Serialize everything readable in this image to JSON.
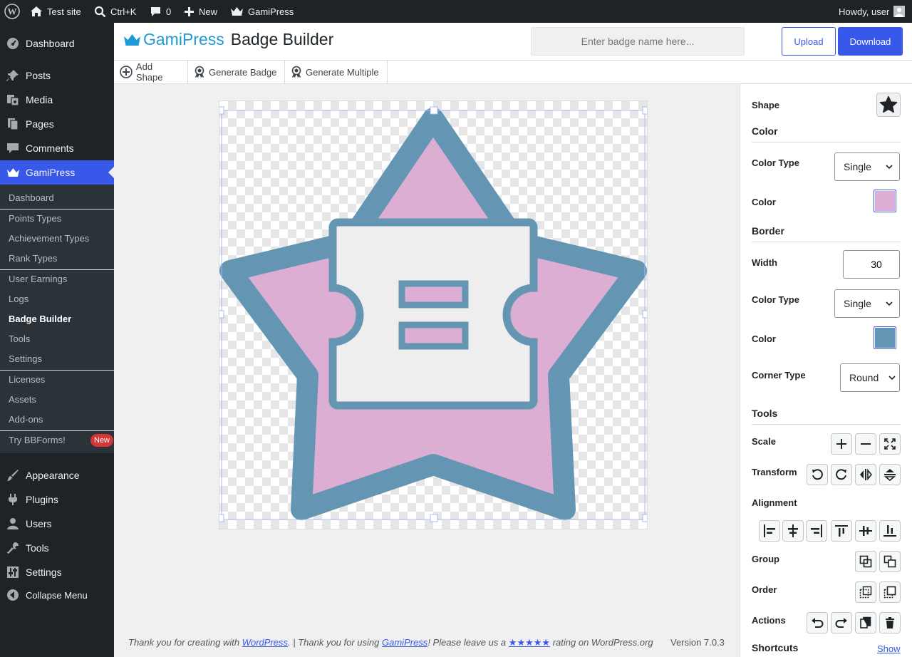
{
  "adminbar": {
    "site_name": "Test site",
    "search_shortcut": "Ctrl+K",
    "comments_count": "0",
    "new_label": "New",
    "plugin_label": "GamiPress",
    "howdy": "Howdy, user"
  },
  "sidebar": {
    "dashboard": "Dashboard",
    "posts": "Posts",
    "media": "Media",
    "pages": "Pages",
    "comments": "Comments",
    "gamipress": "GamiPress",
    "submenu": [
      "Dashboard",
      "Points Types",
      "Achievement Types",
      "Rank Types",
      "User Earnings",
      "Logs",
      "Badge Builder",
      "Tools",
      "Settings",
      "Licenses",
      "Assets",
      "Add-ons",
      "Try BBForms!"
    ],
    "new_badge": "New",
    "appearance": "Appearance",
    "plugins": "Plugins",
    "users": "Users",
    "tools": "Tools",
    "settings": "Settings",
    "collapse": "Collapse Menu"
  },
  "header": {
    "brand": "GamiPress",
    "title": "Badge Builder",
    "badge_name_placeholder": "Enter badge name here...",
    "upload_label": "Upload",
    "download_label": "Download"
  },
  "toolbar": {
    "add_shape": "Add Shape",
    "generate_badge": "Generate Badge",
    "generate_multiple": "Generate Multiple"
  },
  "badge": {
    "fill_color": "#dcaed4",
    "border_color": "#6496b4",
    "inner_color": "#eeeeee"
  },
  "panel": {
    "shape_label": "Shape",
    "shape_icon": "star-icon",
    "color_section": "Color",
    "color_type_label": "Color Type",
    "color_type_value": "Single",
    "color_label": "Color",
    "color_value": "#dcaed4",
    "border_section": "Border",
    "width_label": "Width",
    "width_value": "30",
    "border_color_type_label": "Color Type",
    "border_color_type_value": "Single",
    "border_color_label": "Color",
    "border_color_value": "#6496b4",
    "corner_type_label": "Corner Type",
    "corner_type_value": "Round",
    "tools_section": "Tools",
    "scale_label": "Scale",
    "transform_label": "Transform",
    "alignment_label": "Alignment",
    "group_label": "Group",
    "order_label": "Order",
    "actions_label": "Actions",
    "shortcuts_section": "Shortcuts",
    "shortcuts_show": "Show"
  },
  "footer": {
    "text1": "Thank you for creating with",
    "link1": "WordPress",
    "text2": ". | Thank you for using",
    "link2": "GamiPress",
    "text3": "! Please leave us a",
    "stars": "★★★★★",
    "text4": "rating on WordPress.org",
    "version": "Version 7.0.3"
  },
  "colors": {
    "accent": "#3858e9",
    "brand": "#1e9bd7",
    "admin_dark": "#1d2327"
  }
}
